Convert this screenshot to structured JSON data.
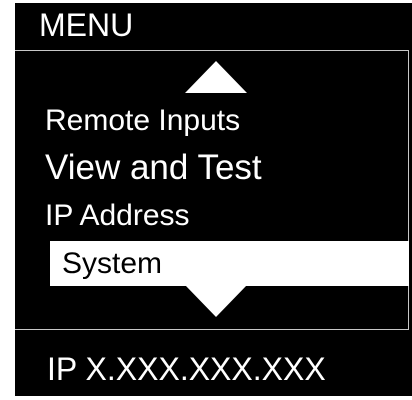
{
  "header": {
    "title": "MENU"
  },
  "nav": {
    "scroll_up_icon": "triangle-up",
    "scroll_down_icon": "triangle-down"
  },
  "menu": {
    "items": [
      {
        "label": "Remote Inputs",
        "selected": false
      },
      {
        "label": "View and Test",
        "selected": false
      },
      {
        "label": "IP Address",
        "selected": false
      },
      {
        "label": "System",
        "selected": true
      }
    ]
  },
  "status": {
    "ip_text": "IP X.XXX.XXX.XXX"
  },
  "colors": {
    "background": "#000000",
    "text": "#ffffff",
    "highlight_background": "#ffffff",
    "highlight_text": "#000000"
  }
}
